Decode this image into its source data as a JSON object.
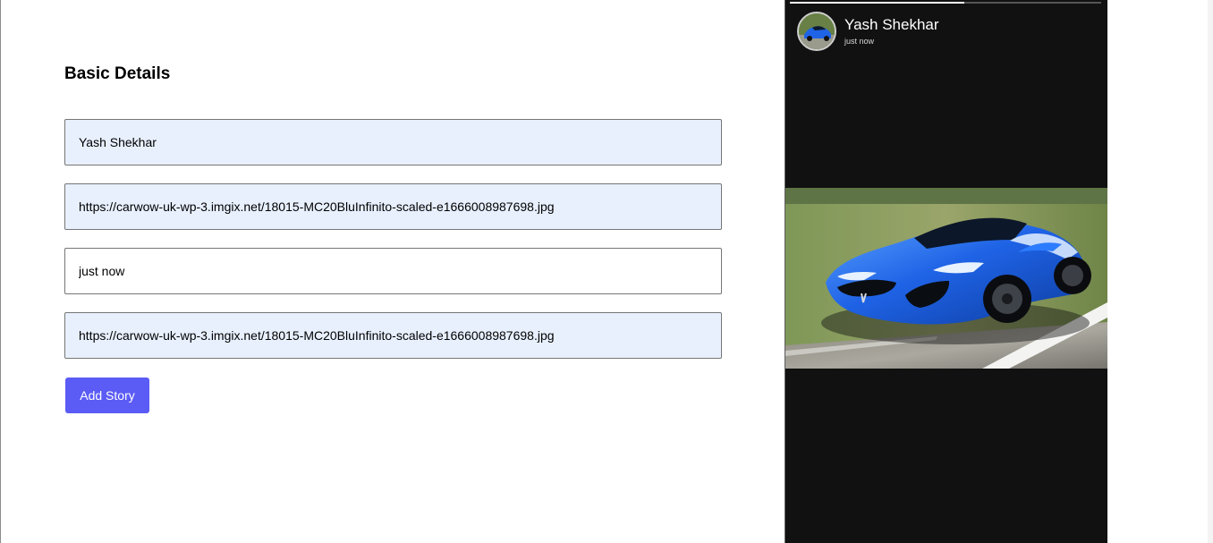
{
  "form": {
    "title": "Basic Details",
    "fields": [
      {
        "value": "Yash Shekhar"
      },
      {
        "value": "https://carwow-uk-wp-3.imgix.net/18015-MC20BluInfinito-scaled-e1666008987698.jpg"
      },
      {
        "value": "just now"
      },
      {
        "value": "https://carwow-uk-wp-3.imgix.net/18015-MC20BluInfinito-scaled-e1666008987698.jpg"
      }
    ],
    "submit_label": "Add Story"
  },
  "story": {
    "author": "Yash Shekhar",
    "time": "just now",
    "progress_percent": 56,
    "image_subject": "blue sports car on road",
    "colors": {
      "background": "#111111",
      "car": "#1f63e6",
      "accent_button": "#5b5bf5"
    }
  }
}
